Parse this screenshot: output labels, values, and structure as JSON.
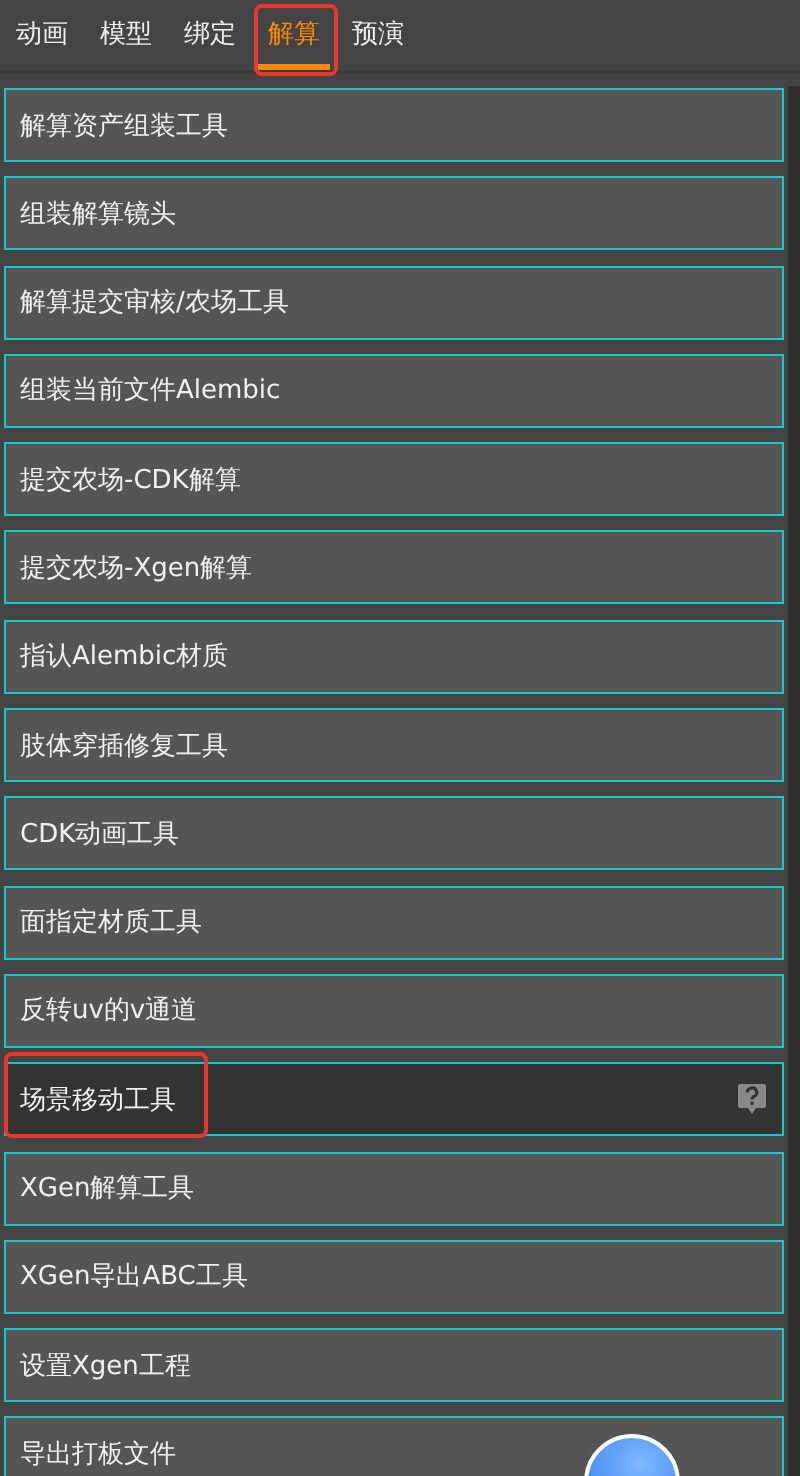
{
  "tabs": [
    {
      "label": "动画",
      "selected": false,
      "highlighted": false
    },
    {
      "label": "模型",
      "selected": false,
      "highlighted": false
    },
    {
      "label": "绑定",
      "selected": false,
      "highlighted": false
    },
    {
      "label": "解算",
      "selected": true,
      "highlighted": true
    },
    {
      "label": "预演",
      "selected": false,
      "highlighted": false
    }
  ],
  "tools": [
    {
      "label": "解算资产组装工具",
      "selected": false,
      "highlighted": false
    },
    {
      "label": "组装解算镜头",
      "selected": false,
      "highlighted": false
    },
    {
      "label": "解算提交审核/农场工具",
      "selected": false,
      "highlighted": false
    },
    {
      "label": "组装当前文件Alembic",
      "selected": false,
      "highlighted": false
    },
    {
      "label": "提交农场-CDK解算",
      "selected": false,
      "highlighted": false
    },
    {
      "label": "提交农场-Xgen解算",
      "selected": false,
      "highlighted": false
    },
    {
      "label": "指认Alembic材质",
      "selected": false,
      "highlighted": false
    },
    {
      "label": "肢体穿插修复工具",
      "selected": false,
      "highlighted": false
    },
    {
      "label": "CDK动画工具",
      "selected": false,
      "highlighted": false
    },
    {
      "label": "面指定材质工具",
      "selected": false,
      "highlighted": false
    },
    {
      "label": "反转uv的v通道",
      "selected": false,
      "highlighted": false
    },
    {
      "label": "场景移动工具",
      "selected": true,
      "highlighted": true
    },
    {
      "label": "XGen解算工具",
      "selected": false,
      "highlighted": false
    },
    {
      "label": "XGen导出ABC工具",
      "selected": false,
      "highlighted": false
    },
    {
      "label": "设置Xgen工程",
      "selected": false,
      "highlighted": false
    },
    {
      "label": "导出打板文件",
      "selected": false,
      "highlighted": false
    }
  ]
}
